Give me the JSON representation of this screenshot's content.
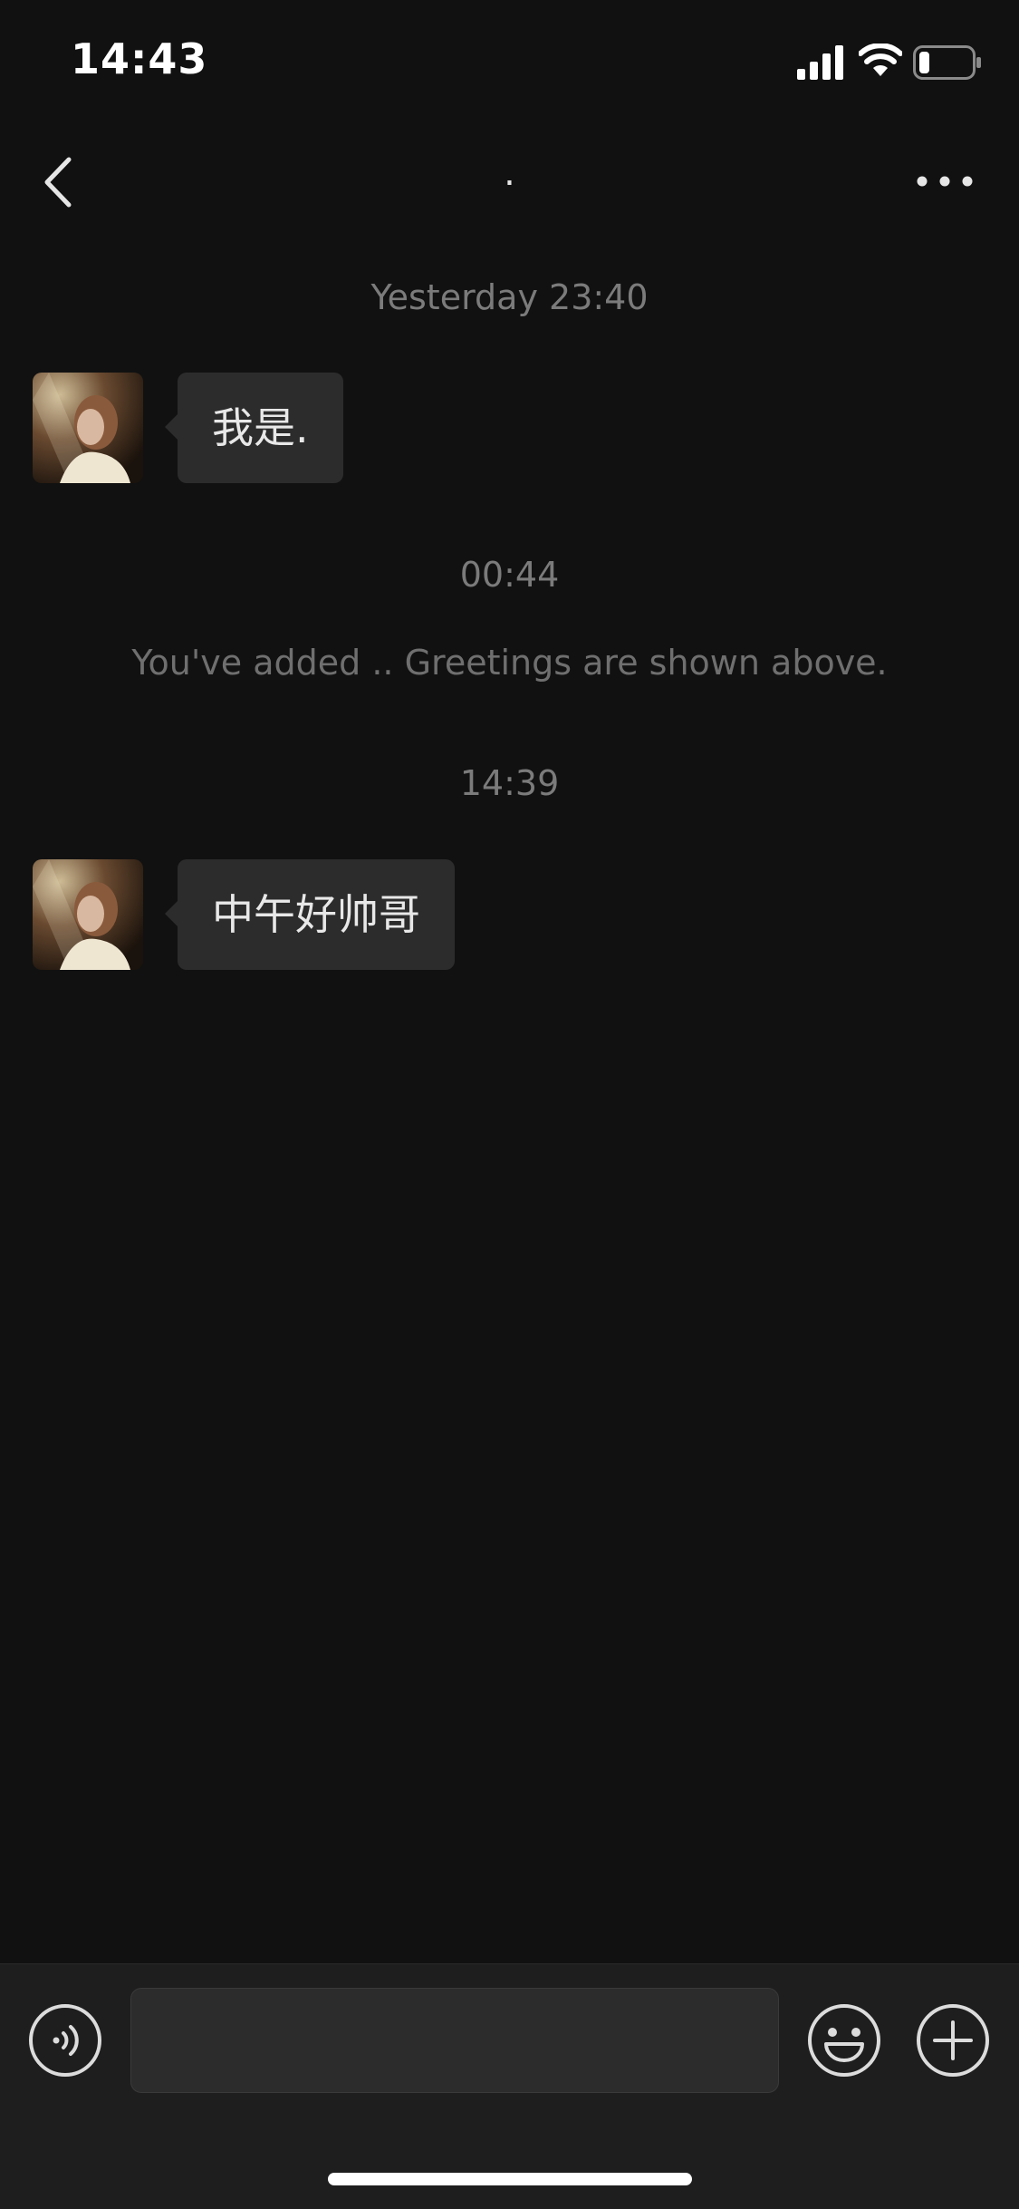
{
  "status_bar": {
    "time": "14:43",
    "icons": [
      "signal-icon",
      "wifi-icon",
      "battery-icon"
    ],
    "battery_level": 0.2
  },
  "nav": {
    "title": ".",
    "back_icon": "chevron-left-icon",
    "more_icon": "more-horizontal-icon"
  },
  "chat": {
    "timestamps": [
      "Yesterday 23:40",
      "00:44",
      "14:39"
    ],
    "system_note": "You've added .. Greetings are shown above.",
    "messages": [
      {
        "sender": "contact",
        "text": "我是."
      },
      {
        "sender": "contact",
        "text": "中午好帅哥"
      }
    ]
  },
  "input_bar": {
    "voice_icon": "voice-icon",
    "emoji_icon": "emoji-icon",
    "plus_icon": "plus-icon",
    "input_value": "",
    "input_placeholder": ""
  },
  "colors": {
    "background": "#111111",
    "bubble": "#2c2c2c",
    "input_bar": "#1e1e1e",
    "timestamp_text": "#7b7b7b"
  }
}
